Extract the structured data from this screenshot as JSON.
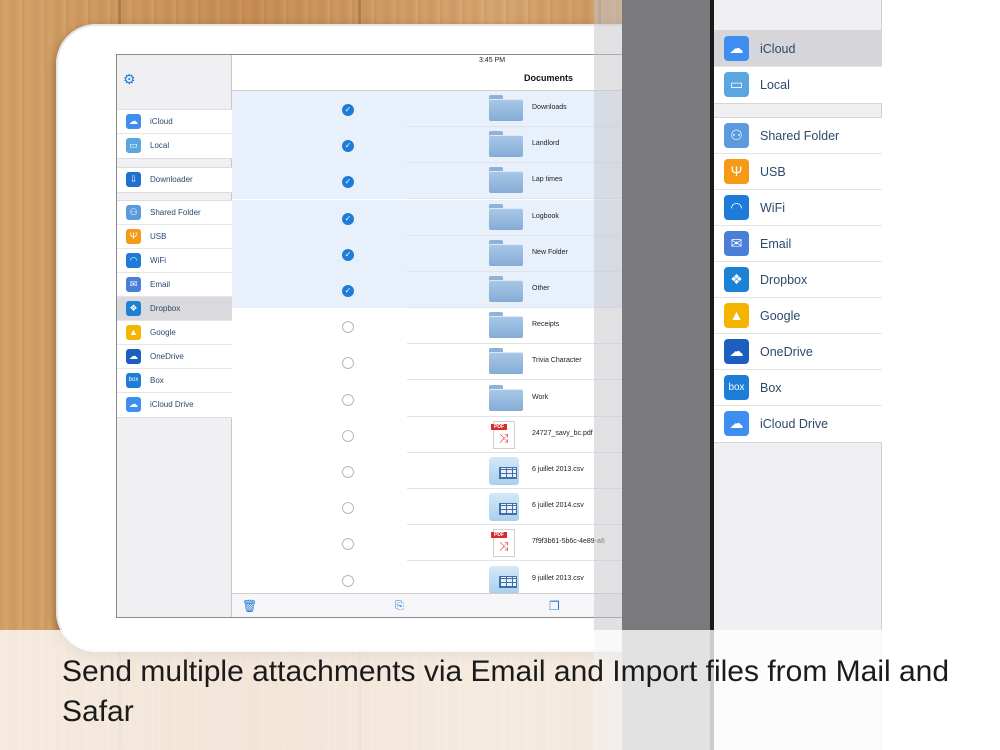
{
  "status": {
    "device": "iPad",
    "time": "3:45 PM"
  },
  "docs": {
    "title": "Documents",
    "files": [
      {
        "name": "Downloads",
        "type": "folder",
        "checked": true
      },
      {
        "name": "Landlord",
        "type": "folder",
        "checked": true
      },
      {
        "name": "Lap times",
        "type": "folder",
        "checked": true
      },
      {
        "name": "Logbook",
        "type": "folder",
        "checked": true
      },
      {
        "name": "New Folder",
        "type": "folder",
        "checked": true
      },
      {
        "name": "Other",
        "type": "folder",
        "checked": true
      },
      {
        "name": "Receipts",
        "type": "folder",
        "checked": false
      },
      {
        "name": "Trivia Character",
        "type": "folder",
        "checked": false
      },
      {
        "name": "Work",
        "type": "folder",
        "checked": false
      },
      {
        "name": "24727_savy_bc.pdf",
        "type": "pdf",
        "checked": false
      },
      {
        "name": "6 juillet 2013.csv",
        "type": "csv",
        "checked": false
      },
      {
        "name": "6 juillet 2014.csv",
        "type": "csv",
        "checked": false
      },
      {
        "name": "7f9f3b61-5b6c-4e89-a6",
        "type": "pdf",
        "checked": false
      },
      {
        "name": "9 juillet 2013.csv",
        "type": "csv",
        "checked": false
      }
    ]
  },
  "sidebar": {
    "groups": [
      [
        {
          "label": "iCloud",
          "icon": "icloud-icon",
          "color": "#3d8ef0",
          "glyph": "☁"
        },
        {
          "label": "Local",
          "icon": "folder-icon",
          "color": "#5aa6e0",
          "glyph": "▭"
        }
      ],
      [
        {
          "label": "Downloader",
          "icon": "download-icon",
          "color": "#1e6fd0",
          "glyph": "⇩"
        }
      ],
      [
        {
          "label": "Shared Folder",
          "icon": "shared-folder-icon",
          "color": "#5a9be0",
          "glyph": "⚇"
        },
        {
          "label": "USB",
          "icon": "usb-icon",
          "color": "#f59a16",
          "glyph": "Ψ"
        },
        {
          "label": "WiFi",
          "icon": "wifi-icon",
          "color": "#1e7bd8",
          "glyph": "◠"
        },
        {
          "label": "Email",
          "icon": "mail-icon",
          "color": "#4a7fd8",
          "glyph": "✉"
        },
        {
          "label": "Dropbox",
          "icon": "dropbox-icon",
          "color": "#1b82d6",
          "glyph": "❖",
          "selected": true
        },
        {
          "label": "Google",
          "icon": "google-drive-icon",
          "color": "#f5b400",
          "glyph": "▲"
        },
        {
          "label": "OneDrive",
          "icon": "onedrive-icon",
          "color": "#1c5fbf",
          "glyph": "☁"
        },
        {
          "label": "Box",
          "icon": "box-icon",
          "color": "#1c7ed6",
          "glyph": "box"
        },
        {
          "label": "iCloud Drive",
          "icon": "icloud-drive-icon",
          "color": "#3d8ef0",
          "glyph": "☁"
        }
      ]
    ]
  },
  "zoom_sidebar": {
    "groups": [
      [
        {
          "label": "iCloud",
          "icon": "icloud-icon",
          "color": "#3d8ef0",
          "glyph": "☁",
          "selected": true
        },
        {
          "label": "Local",
          "icon": "folder-icon",
          "color": "#5aa6e0",
          "glyph": "▭"
        }
      ],
      [
        {
          "label": "Shared Folder",
          "icon": "shared-folder-icon",
          "color": "#5a9be0",
          "glyph": "⚇"
        },
        {
          "label": "USB",
          "icon": "usb-icon",
          "color": "#f59a16",
          "glyph": "Ψ"
        },
        {
          "label": "WiFi",
          "icon": "wifi-icon",
          "color": "#1e7bd8",
          "glyph": "◠"
        },
        {
          "label": "Email",
          "icon": "mail-icon",
          "color": "#4a7fd8",
          "glyph": "✉"
        },
        {
          "label": "Dropbox",
          "icon": "dropbox-icon",
          "color": "#1b82d6",
          "glyph": "❖"
        },
        {
          "label": "Google",
          "icon": "google-drive-icon",
          "color": "#f5b400",
          "glyph": "▲"
        },
        {
          "label": "OneDrive",
          "icon": "onedrive-icon",
          "color": "#1c5fbf",
          "glyph": "☁"
        },
        {
          "label": "Box",
          "icon": "box-icon",
          "color": "#1c7ed6",
          "glyph": "box"
        },
        {
          "label": "iCloud Drive",
          "icon": "icloud-drive-icon",
          "color": "#3d8ef0",
          "glyph": "☁"
        }
      ]
    ]
  },
  "toolbar": {
    "trash_icon": "trash-icon",
    "move_icon": "folder-move-icon",
    "copy_icon": "copy-icon"
  },
  "caption": "Send multiple attachments via Email and Import files from Mail and Safar"
}
